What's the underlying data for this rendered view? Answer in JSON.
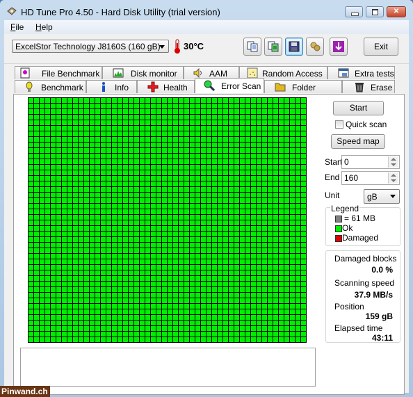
{
  "window": {
    "title": "HD Tune Pro 4.50 - Hard Disk Utility (trial version)",
    "app_icon": "hdd-icon",
    "controls": [
      "minimize",
      "maximize",
      "close"
    ]
  },
  "menu": {
    "items": [
      {
        "label": "File",
        "accel": "F"
      },
      {
        "label": "Help",
        "accel": "H"
      }
    ]
  },
  "toolbar": {
    "drive": "ExcelStor Technology J8160S (160 gB)",
    "temperature": "30°C",
    "buttons": [
      {
        "name": "copy-text-icon"
      },
      {
        "name": "copy-screenshot-icon"
      },
      {
        "name": "save-icon"
      },
      {
        "name": "options-icon"
      },
      {
        "name": "download-icon"
      }
    ],
    "exit_label": "Exit"
  },
  "tabs": {
    "row1": [
      {
        "label": "File Benchmark",
        "icon": "file-benchmark-icon"
      },
      {
        "label": "Disk monitor",
        "icon": "disk-monitor-icon"
      },
      {
        "label": "AAM",
        "icon": "speaker-icon"
      },
      {
        "label": "Random Access",
        "icon": "random-access-icon"
      },
      {
        "label": "Extra tests",
        "icon": "extra-tests-icon"
      }
    ],
    "row2": [
      {
        "label": "Benchmark",
        "icon": "benchmark-icon"
      },
      {
        "label": "Info",
        "icon": "info-icon"
      },
      {
        "label": "Health",
        "icon": "health-icon"
      },
      {
        "label": "Error Scan",
        "icon": "magnifier-icon",
        "active": true
      },
      {
        "label": "Folder Usage",
        "icon": "folder-icon"
      },
      {
        "label": "Erase",
        "icon": "trash-icon"
      }
    ]
  },
  "scan": {
    "grid_cols": 50,
    "grid_rows": 44,
    "block_status": "ok",
    "colors": {
      "ok": "#00ee00",
      "damaged": "#e00000",
      "unscanned": "#808080",
      "grid": "#000000"
    }
  },
  "controls": {
    "start_label": "Start",
    "quick_scan_label": "Quick scan",
    "quick_scan_checked": false,
    "speed_map_label": "Speed map",
    "start_field_label": "Start",
    "start_value": "0",
    "end_field_label": "End",
    "end_value": "160",
    "unit_label": "Unit",
    "unit_value": "gB"
  },
  "legend": {
    "title": "Legend",
    "items": [
      {
        "label": "= 61 MB",
        "color": "#808080"
      },
      {
        "label": "Ok",
        "color": "#00ee00"
      },
      {
        "label": "Damaged",
        "color": "#e00000"
      }
    ]
  },
  "stats": {
    "damaged_blocks_label": "Damaged blocks",
    "damaged_blocks_value": "0.0 %",
    "scanning_speed_label": "Scanning speed",
    "scanning_speed_value": "37.9 MB/s",
    "position_label": "Position",
    "position_value": "159 gB",
    "elapsed_label": "Elapsed time",
    "elapsed_value": "43:11"
  },
  "watermark": "Pinwand.ch"
}
